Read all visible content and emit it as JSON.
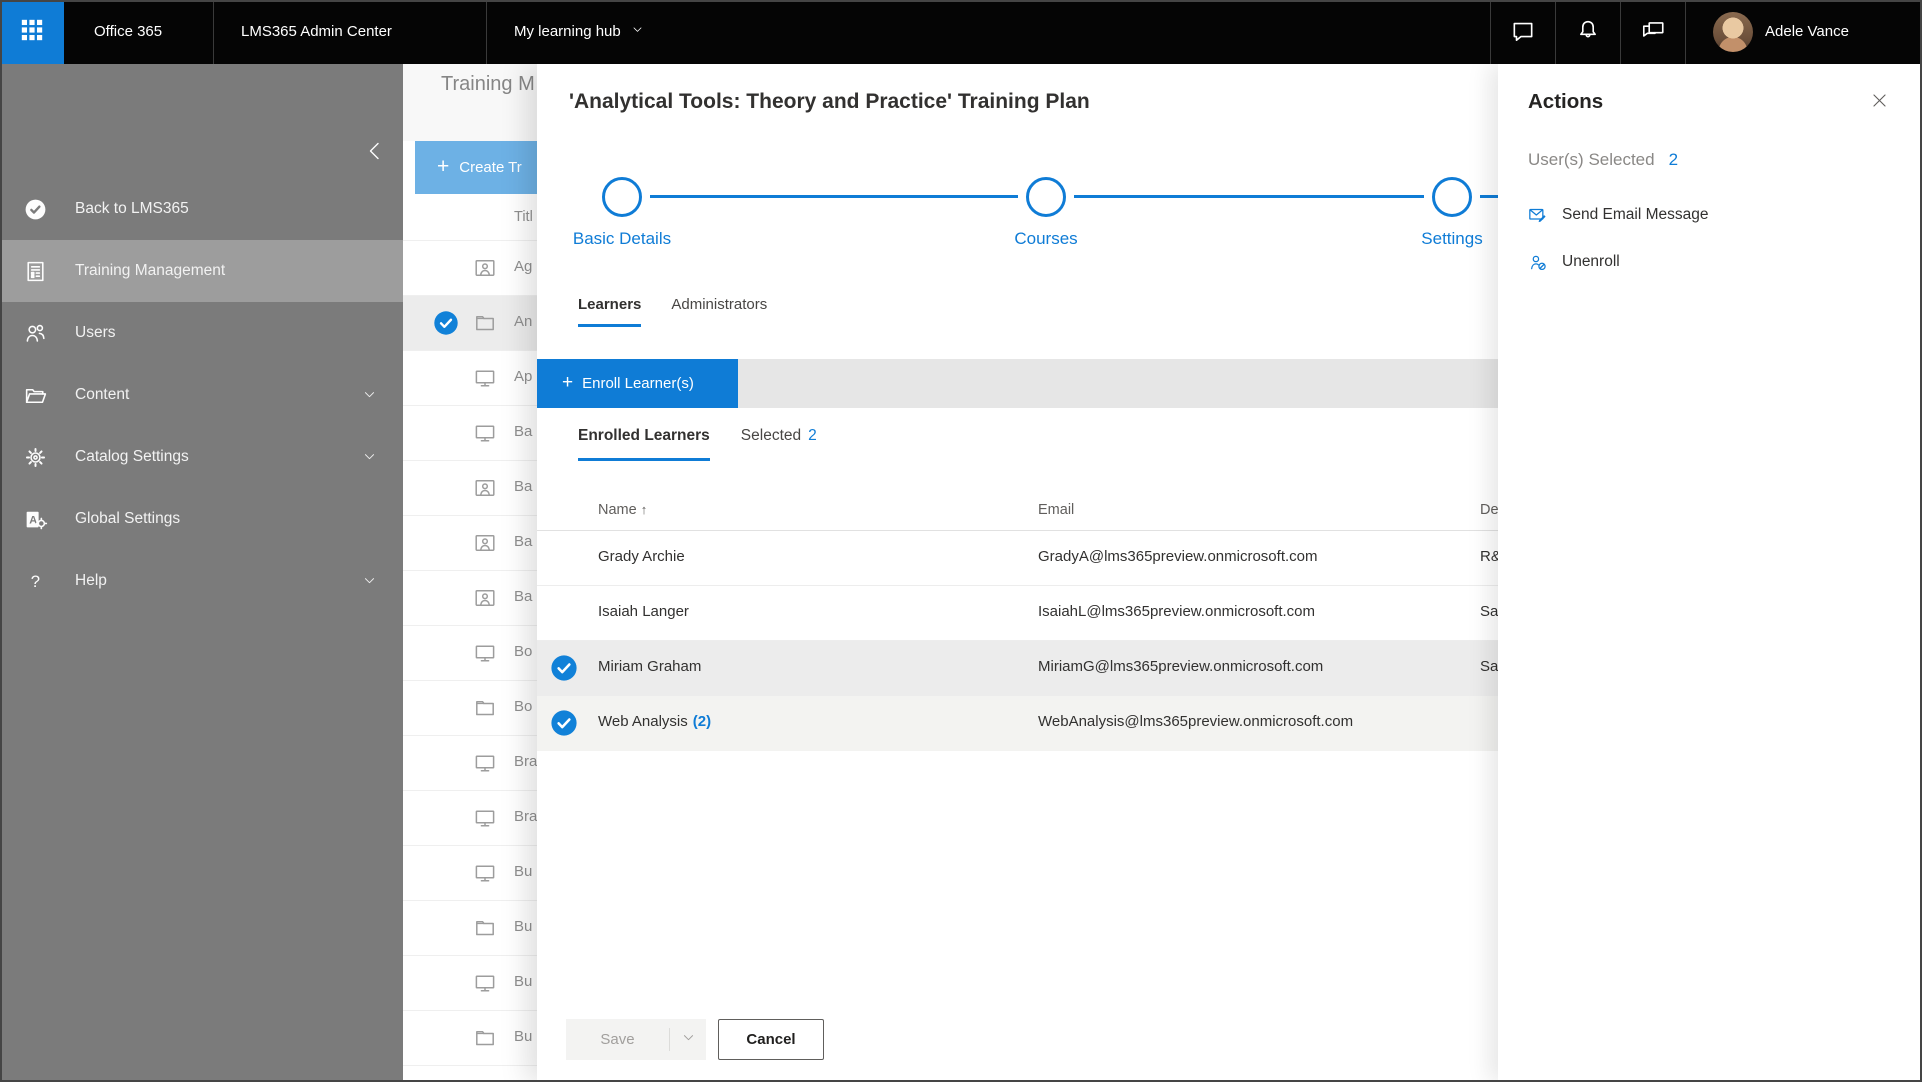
{
  "colors": {
    "accent": "#0f7cd6",
    "topbar": "#050505",
    "sidebar": "#7b7b7b",
    "sidebar_selected": "#9d9d9d",
    "create_btn": "#6db1e5",
    "toolbar_band": "#e6e6e6",
    "row_selected": "#ececec",
    "row_selected_alt": "#f3f3f1",
    "check": "#1181d8"
  },
  "topbar": {
    "brand": "Office 365",
    "app_title": "LMS365 Admin Center",
    "hub_label": "My learning hub",
    "user_name": "Adele Vance",
    "icons": [
      "chat-icon",
      "bell-icon",
      "feedback-icon"
    ]
  },
  "sidebar": {
    "items": [
      {
        "label": "Back to LMS365",
        "icon": "lms365-logo",
        "selected": false,
        "chevron": false
      },
      {
        "label": "Training Management",
        "icon": "training-doc",
        "selected": true,
        "chevron": false
      },
      {
        "label": "Users",
        "icon": "users",
        "selected": false,
        "chevron": false
      },
      {
        "label": "Content",
        "icon": "folder-open",
        "selected": false,
        "chevron": true
      },
      {
        "label": "Catalog Settings",
        "icon": "gear",
        "selected": false,
        "chevron": true
      },
      {
        "label": "Global Settings",
        "icon": "global-a",
        "selected": false,
        "chevron": false
      },
      {
        "label": "Help",
        "icon": "help",
        "selected": false,
        "chevron": true
      }
    ]
  },
  "background_page": {
    "title": "Training M",
    "create_label": "Create Tr",
    "column_header": "Titl",
    "rows": [
      {
        "label": "Ag",
        "icon": "person-card",
        "checked": false
      },
      {
        "label": "An",
        "icon": "folder",
        "checked": true
      },
      {
        "label": "Ap",
        "icon": "monitor",
        "checked": false
      },
      {
        "label": "Ba",
        "icon": "monitor",
        "checked": false
      },
      {
        "label": "Ba",
        "icon": "person-card",
        "checked": false
      },
      {
        "label": "Ba",
        "icon": "person-card",
        "checked": false
      },
      {
        "label": "Ba",
        "icon": "person-card",
        "checked": false
      },
      {
        "label": "Bo",
        "icon": "monitor",
        "checked": false
      },
      {
        "label": "Bo",
        "icon": "folder",
        "checked": false
      },
      {
        "label": "Bra",
        "icon": "monitor",
        "checked": false
      },
      {
        "label": "Bra",
        "icon": "monitor",
        "checked": false
      },
      {
        "label": "Bu",
        "icon": "monitor",
        "checked": false
      },
      {
        "label": "Bu",
        "icon": "folder",
        "checked": false
      },
      {
        "label": "Bu",
        "icon": "monitor",
        "checked": false
      },
      {
        "label": "Bu",
        "icon": "folder",
        "checked": false
      }
    ]
  },
  "panel": {
    "title": "'Analytical Tools: Theory and Practice' Training Plan",
    "stepper": [
      {
        "label": "Basic Details"
      },
      {
        "label": "Courses"
      },
      {
        "label": "Settings"
      }
    ],
    "tabs": [
      {
        "label": "Learners",
        "active": true
      },
      {
        "label": "Administrators",
        "active": false
      }
    ],
    "enroll_label": "Enroll Learner(s)",
    "subtabs": {
      "enrolled_label": "Enrolled Learners",
      "selected_label": "Selected",
      "selected_count": "2"
    },
    "table": {
      "columns": [
        "Name",
        "Email",
        "De"
      ],
      "sort_arrow": "↑",
      "rows": [
        {
          "name": "Grady Archie",
          "suffix": "",
          "email": "GradyA@lms365preview.onmicrosoft.com",
          "dept": "R&",
          "checked": false
        },
        {
          "name": "Isaiah Langer",
          "suffix": "",
          "email": "IsaiahL@lms365preview.onmicrosoft.com",
          "dept": "Sa",
          "checked": false
        },
        {
          "name": "Miriam Graham",
          "suffix": "",
          "email": "MiriamG@lms365preview.onmicrosoft.com",
          "dept": "Sa",
          "checked": true
        },
        {
          "name": "Web Analysis",
          "suffix": "(2)",
          "email": "WebAnalysis@lms365preview.onmicrosoft.com",
          "dept": "",
          "checked": true
        }
      ]
    },
    "save_label": "Save",
    "cancel_label": "Cancel"
  },
  "actions": {
    "title": "Actions",
    "users_selected_label": "User(s) Selected",
    "selected_count": "2",
    "items": [
      {
        "label": "Send Email Message",
        "icon": "email-edit"
      },
      {
        "label": "Unenroll",
        "icon": "unenroll"
      }
    ]
  }
}
